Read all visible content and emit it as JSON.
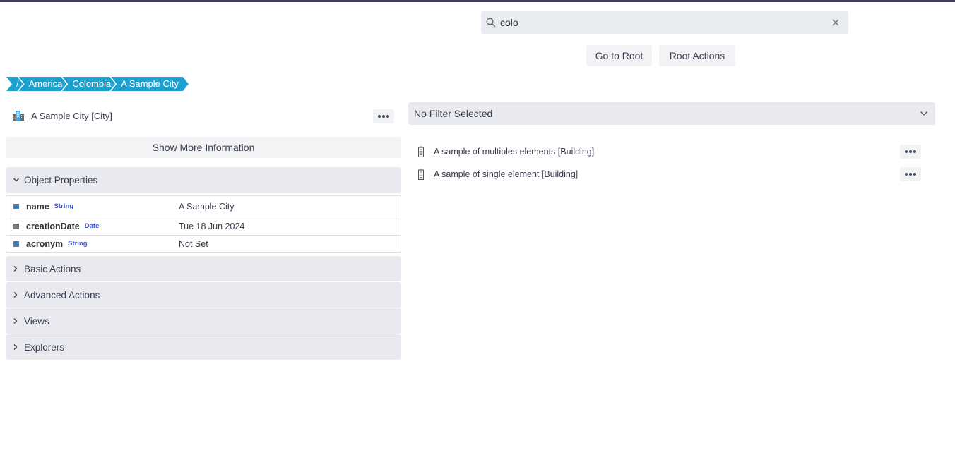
{
  "search": {
    "value": "colo",
    "icon": "search-icon",
    "clear_icon": "close-icon"
  },
  "toolbar": {
    "go_to_root": "Go to Root",
    "root_actions": "Root Actions"
  },
  "breadcrumb": [
    {
      "label": "/"
    },
    {
      "label": "America"
    },
    {
      "label": "Colombia"
    },
    {
      "label": "A Sample City"
    }
  ],
  "object": {
    "title": "A Sample City [City]",
    "icon": "city-building-icon",
    "show_more": "Show More Information"
  },
  "sections": {
    "object_properties": "Object Properties",
    "basic_actions": "Basic Actions",
    "advanced_actions": "Advanced Actions",
    "views": "Views",
    "explorers": "Explorers"
  },
  "properties": [
    {
      "name": "name",
      "type": "String",
      "value": "A Sample City",
      "color": "#4a7ea8"
    },
    {
      "name": "creationDate",
      "type": "Date",
      "value": "Tue 18 Jun 2024",
      "color": "#7a7a7a"
    },
    {
      "name": "acronym",
      "type": "String",
      "value": "Not Set",
      "color": "#4a7ea8"
    }
  ],
  "filter": {
    "label": "No Filter Selected"
  },
  "children": [
    {
      "label": "A sample of multiples elements [Building]",
      "icon": "building-icon"
    },
    {
      "label": "A sample of single element [Building]",
      "icon": "building-icon"
    }
  ],
  "colors": {
    "topbar": "#3f3d5a",
    "breadcrumb": "#1ca0cf",
    "type_badge": "#3b57d6"
  }
}
